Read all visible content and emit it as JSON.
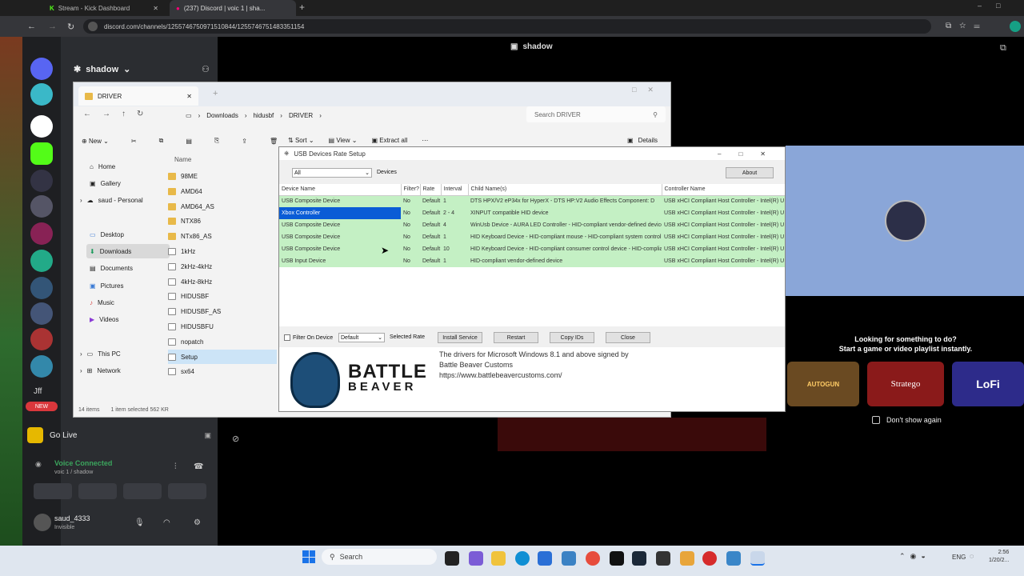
{
  "browser": {
    "tabs": [
      {
        "label": "Stream - Kick Dashboard"
      },
      {
        "label": "(237) Discord | voic 1 | sha..."
      }
    ],
    "url": "discord.com/channels/1255746750971510844/1255746751483351154"
  },
  "discord": {
    "server_name": "shadow",
    "stage_title": "shadow",
    "guild_labels": {
      "jff": "Jff",
      "new": "NEW"
    },
    "go_live": "Go Live",
    "voice_connected": "Voice Connected",
    "voice_channel": "voic 1 / shadow",
    "username": "saud_4333",
    "user_status": "Invisible",
    "activity_line1": "Looking for something to do?",
    "activity_line2": "Start a game or video playlist instantly.",
    "activity_games": [
      "AUTOGUN",
      "Stratego",
      "LoFi"
    ],
    "dont_show": "Don't show again"
  },
  "explorer": {
    "tab_title": "DRIVER",
    "breadcrumb": [
      "Downloads",
      "hidusbf",
      "DRIVER"
    ],
    "search_placeholder": "Search DRIVER",
    "toolbar": {
      "new": "New",
      "sort": "Sort",
      "view": "View",
      "extract": "Extract all",
      "details": "Details"
    },
    "nav": [
      "Home",
      "Gallery",
      "saud - Personal",
      "Desktop",
      "Downloads",
      "Documents",
      "Pictures",
      "Music",
      "Videos",
      "This PC",
      "Network"
    ],
    "column_name": "Name",
    "files": [
      "98ME",
      "AMD64",
      "AMD64_AS",
      "NTX86",
      "NTx86_AS",
      "1kHz",
      "2kHz-4kHz",
      "4kHz-8kHz",
      "HIDUSBF",
      "HIDUSBF_AS",
      "HIDUSBFU",
      "nopatch",
      "Setup",
      "sx64"
    ],
    "status_items": "14 items",
    "status_selected": "1 item selected  562 KR"
  },
  "dialog": {
    "title": "USB Devices Rate Setup",
    "filter_value": "All",
    "devices_label": "Devices",
    "about": "About",
    "columns": [
      "Device Name",
      "Filter?",
      "Rate",
      "Interval",
      "Child Name(s)",
      "Controller Name"
    ],
    "rows": [
      [
        "USB Composite Device",
        "No",
        "Default",
        "1",
        "DTS HPX/V2 eP34x for HyperX - DTS HP:V2 Audio Effects Component: D",
        "USB xHCI Compliant Host Controller - Intel(R) U"
      ],
      [
        "Xbox Controller",
        "No",
        "Default",
        "2 - 4",
        "XINPUT compatible HID device",
        "USB xHCI Compliant Host Controller - Intel(R) U"
      ],
      [
        "USB Composite Device",
        "No",
        "Default",
        "4",
        "WinUsb Device - AURA LED Controller - HID-compliant vendor-defined device",
        "USB xHCI Compliant Host Controller - Intel(R) U"
      ],
      [
        "USB Composite Device",
        "No",
        "Default",
        "1",
        "HID Keyboard Device - HID-compliant mouse - HID-compliant system controll",
        "USB xHCI Compliant Host Controller - Intel(R) U"
      ],
      [
        "USB Composite Device",
        "No",
        "Default",
        "10",
        "HID Keyboard Device - HID-compliant consumer control device - HID-compliant",
        "USB xHCI Compliant Host Controller - Intel(R) U"
      ],
      [
        "USB Input Device",
        "No",
        "Default",
        "1",
        "HID-compliant vendor-defined device",
        "USB xHCI Compliant Host Controller - Intel(R) U"
      ]
    ],
    "filter_on_device": "Filter On Device",
    "rate_select": "Default",
    "selected_rate": "Selected Rate",
    "install": "Install Service",
    "restart": "Restart",
    "copy_ids": "Copy IDs",
    "close": "Close",
    "info_line1": "The drivers for Microsoft Windows 8.1 and above signed by",
    "info_line2": "Battle Beaver Customs",
    "info_line3": "https://www.battlebeavercustoms.com/",
    "logo_top": "BATTLE",
    "logo_bottom": "BEAVER"
  },
  "taskbar": {
    "search": "Search",
    "lang": "ENG",
    "time": "2:56",
    "date": "1/20/2..."
  }
}
